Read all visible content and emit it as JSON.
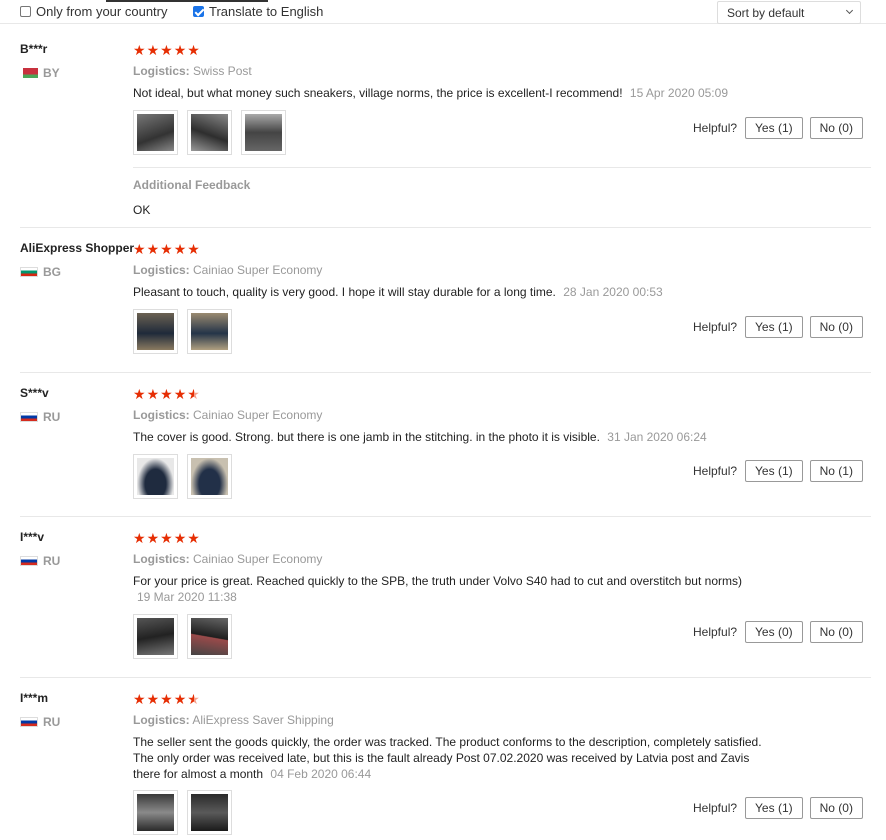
{
  "filters": {
    "only_country_label": "Only from your country",
    "only_country_checked": false,
    "translate_label": "Translate to English",
    "translate_checked": true,
    "sort_value": "Sort by default"
  },
  "helpful_label": "Helpful?",
  "logistics_label": "Logistics:",
  "reviews": [
    {
      "user": "B***r",
      "country": "BY",
      "stars": 5,
      "logistics": "Swiss Post",
      "text": "Not ideal, but what money such sneakers, village norms, the price is excellent-I recommend!",
      "date": "15 Apr 2020 05:09",
      "photos": 3,
      "yes": "Yes (1)",
      "no": "No (0)",
      "additional_title": "Additional Feedback",
      "additional_text": "OK"
    },
    {
      "user": "AliExpress Shopper",
      "country": "BG",
      "stars": 5,
      "logistics": "Cainiao Super Economy",
      "text": "Pleasant to touch, quality is very good. I hope it will stay durable for a long time.",
      "date": "28 Jan 2020 00:53",
      "photos": 2,
      "yes": "Yes (1)",
      "no": "No (0)"
    },
    {
      "user": "S***v",
      "country": "RU",
      "stars": 4.5,
      "logistics": "Cainiao Super Economy",
      "text": "The cover is good. Strong. but there is one jamb in the stitching. in the photo it is visible.",
      "date": "31 Jan 2020 06:24",
      "photos": 2,
      "yes": "Yes (1)",
      "no": "No (1)"
    },
    {
      "user": "I***v",
      "country": "RU",
      "stars": 5,
      "logistics": "Cainiao Super Economy",
      "text": "For your price is great. Reached quickly to the SPB, the truth under Volvo S40 had to cut and overstitch but norms)",
      "date": "19 Mar 2020 11:38",
      "photos": 2,
      "yes": "Yes (0)",
      "no": "No (0)"
    },
    {
      "user": "I***m",
      "country": "RU",
      "stars": 4.5,
      "logistics": "AliExpress Saver Shipping",
      "text": "The seller sent the goods quickly, the order was tracked. The product conforms to the description, completely satisfied. The only order was received late, but this is the fault already Post 07.02.2020 was received by Latvia post and Zavis there for almost a month",
      "date": "04 Feb 2020 06:44",
      "photos": 2,
      "yes": "Yes (1)",
      "no": "No (0)"
    }
  ],
  "colors": {
    "star": "#e62e04",
    "muted": "#999999",
    "checkbox": "#1a73e8"
  }
}
